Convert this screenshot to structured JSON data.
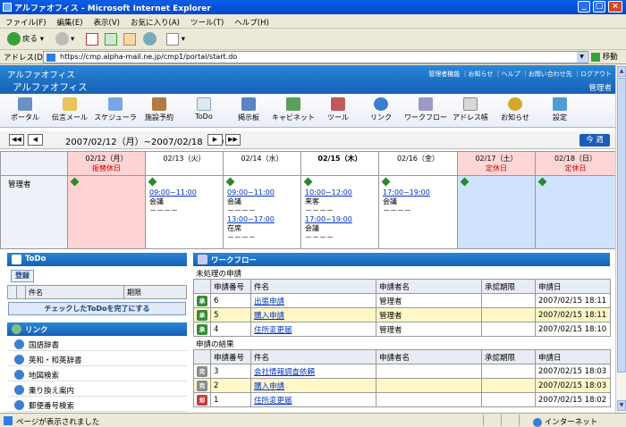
{
  "window": {
    "title": "アルファオフィス - Microsoft Internet Explorer"
  },
  "menu": [
    "ファイル(F)",
    "編集(E)",
    "表示(V)",
    "お気に入り(A)",
    "ツール(T)",
    "ヘルプ(H)"
  ],
  "toolbar": {
    "back": "戻る"
  },
  "address": {
    "label": "アドレス(D)",
    "url": "https://cmp.alpha-mail.ne.jp/cmp1/portal/start.do",
    "go": "移動"
  },
  "status": {
    "text": "ページが表示されました",
    "zone": "インターネット"
  },
  "header": {
    "brand": "アルファオフィス",
    "company": "アルファオフィス",
    "links": "管理者機能 ｜お知らせ ｜ヘルプ ｜お問い合わせ先 ｜ログアウト",
    "user": "管理者"
  },
  "nav": [
    "ポータル",
    "伝言メール",
    "スケジューラ",
    "施設予約",
    "ToDo",
    "掲示板",
    "キャビネット",
    "ツール",
    "リンク",
    "ワークフロー",
    "アドレス帳",
    "お知らせ",
    "設定"
  ],
  "schedule": {
    "range": "2007/02/12（月）~2007/02/18（日）",
    "this_week": "今 週",
    "member": "管理者",
    "days": [
      {
        "date": "02/12（月）",
        "note": "振替休日",
        "entries": []
      },
      {
        "date": "02/13（火）",
        "note": "",
        "entries": [
          {
            "time": "09:00~11:00",
            "title": "会議",
            "sub": "－－－－"
          }
        ]
      },
      {
        "date": "02/14（水）",
        "note": "",
        "entries": [
          {
            "time": "09:00~11:00",
            "title": "会議",
            "sub": "－－－－"
          },
          {
            "time": "13:00~17:00",
            "title": "在席",
            "sub": "－－－－"
          }
        ]
      },
      {
        "date": "02/15（木）",
        "note": "",
        "entries": [
          {
            "time": "10:00~12:00",
            "title": "来客",
            "sub": "－－－－"
          },
          {
            "time": "17:00~19:00",
            "title": "会議",
            "sub": "－－－－"
          }
        ]
      },
      {
        "date": "02/16（金）",
        "note": "",
        "entries": [
          {
            "time": "17:00~19:00",
            "title": "会議",
            "sub": "－－－－"
          }
        ]
      },
      {
        "date": "02/17（土）",
        "note": "定休日",
        "entries": []
      },
      {
        "date": "02/18（日）",
        "note": "定休日",
        "entries": []
      }
    ]
  },
  "todo": {
    "title": "ToDo",
    "register": "登録",
    "col_name": "件名",
    "col_due": "期限",
    "done_button": "チェックしたToDoを完了にする"
  },
  "links": {
    "title": "リンク",
    "items": [
      "国語辞書",
      "英和・和英辞書",
      "地図検索",
      "乗り換え案内",
      "郵便番号検索"
    ]
  },
  "workflow": {
    "title": "ワークフロー",
    "pending_title": "未処理の申請",
    "result_title": "申請の結果",
    "cols": [
      "申請番号",
      "件名",
      "申請者名",
      "承認期限",
      "申請日"
    ],
    "pending": [
      {
        "badge": "承",
        "no": "6",
        "subject": "出張申請",
        "applicant": "管理者",
        "limit": "",
        "date": "2007/02/15 18:11"
      },
      {
        "badge": "承",
        "no": "5",
        "subject": "購入申請",
        "applicant": "管理者",
        "limit": "",
        "date": "2007/02/15 18:11"
      },
      {
        "badge": "承",
        "no": "4",
        "subject": "住所変更届",
        "applicant": "管理者",
        "limit": "",
        "date": "2007/02/15 18:10"
      }
    ],
    "results": [
      {
        "badge": "完",
        "no": "3",
        "subject": "会社情報調査依頼",
        "applicant": "",
        "limit": "",
        "date": "2007/02/15 18:03"
      },
      {
        "badge": "完",
        "no": "2",
        "subject": "購入申請",
        "applicant": "",
        "limit": "",
        "date": "2007/02/15 18:03"
      },
      {
        "badge": "却",
        "no": "1",
        "subject": "住所変更届",
        "applicant": "",
        "limit": "",
        "date": "2007/02/15 18:02"
      }
    ]
  }
}
